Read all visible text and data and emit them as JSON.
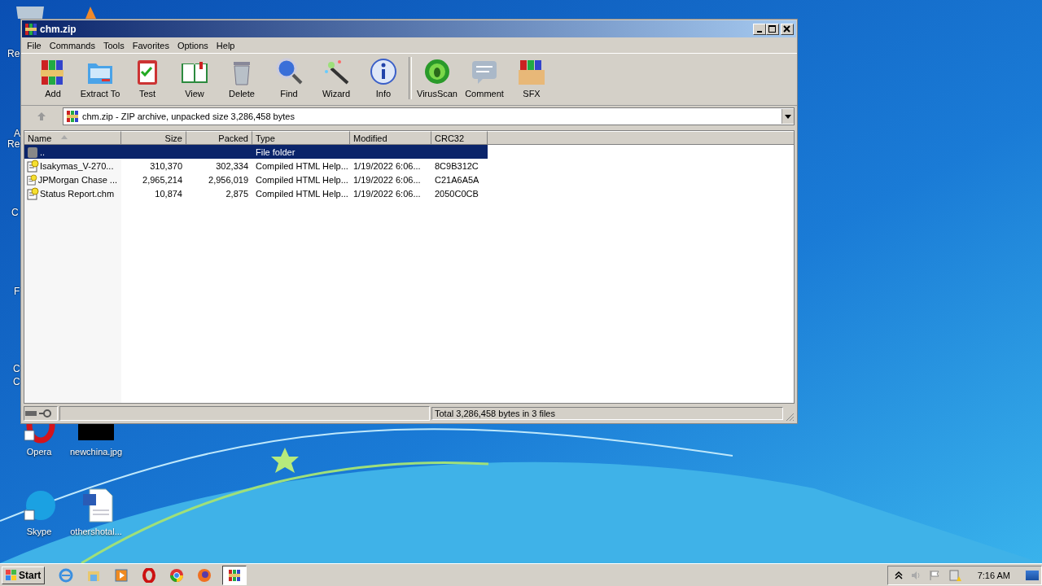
{
  "desktop": {
    "edge_labels": [
      "Re",
      "A",
      "Re",
      "C",
      "F",
      "C",
      "C"
    ],
    "icons": [
      {
        "label": "Opera",
        "kind": "opera"
      },
      {
        "label": "newchina.jpg"
      },
      {
        "label": "Skype",
        "kind": "skype"
      },
      {
        "label": "othershotal...",
        "kind": "word"
      }
    ]
  },
  "window": {
    "title": "chm.zip",
    "menu": [
      "File",
      "Commands",
      "Tools",
      "Favorites",
      "Options",
      "Help"
    ],
    "toolbar_groups": [
      {
        "buttons": [
          {
            "label": "Add",
            "kind": "add"
          },
          {
            "label": "Extract To",
            "kind": "extract"
          },
          {
            "label": "Test",
            "kind": "test"
          },
          {
            "label": "View",
            "kind": "view"
          },
          {
            "label": "Delete",
            "kind": "delete"
          },
          {
            "label": "Find",
            "kind": "find"
          },
          {
            "label": "Wizard",
            "kind": "wizard"
          },
          {
            "label": "Info",
            "kind": "info"
          }
        ]
      },
      {
        "buttons": [
          {
            "label": "VirusScan",
            "kind": "virus"
          },
          {
            "label": "Comment",
            "kind": "comment"
          },
          {
            "label": "SFX",
            "kind": "sfx"
          }
        ]
      }
    ],
    "address": "chm.zip - ZIP archive, unpacked size 3,286,458 bytes",
    "table": {
      "columns": [
        {
          "label": "Name",
          "sorted": true
        },
        {
          "label": "Size",
          "sorted": false
        },
        {
          "label": "Packed",
          "sorted": false
        },
        {
          "label": "Type",
          "sorted": false
        },
        {
          "label": "Modified",
          "sorted": false
        },
        {
          "label": "CRC32",
          "sorted": false
        }
      ],
      "rows": [
        {
          "kind": "folder",
          "selected": true,
          "name": "..",
          "type": "File folder"
        },
        {
          "kind": "chm",
          "selected": false,
          "name": "Isakymas_V-270...",
          "size": "310,370",
          "packed": "302,334",
          "type": "Compiled HTML Help...",
          "modified": "1/19/2022 6:06...",
          "crc32": "8C9B312C"
        },
        {
          "kind": "chm",
          "selected": false,
          "name": "JPMorgan Chase ...",
          "size": "2,965,214",
          "packed": "2,956,019",
          "type": "Compiled HTML Help...",
          "modified": "1/19/2022 6:06...",
          "crc32": "C21A6A5A"
        },
        {
          "kind": "chm",
          "selected": false,
          "name": "Status Report.chm",
          "size": "10,874",
          "packed": "2,875",
          "type": "Compiled HTML Help...",
          "modified": "1/19/2022 6:06...",
          "crc32": "2050C0CB"
        }
      ]
    },
    "status_bar": "Total 3,286,458 bytes in 3 files"
  },
  "taskbar": {
    "start": "Start",
    "apps": [
      {
        "kind": "ie",
        "selected": false
      },
      {
        "kind": "explorer",
        "selected": false
      },
      {
        "kind": "media",
        "selected": false
      },
      {
        "kind": "opera",
        "selected": false
      },
      {
        "kind": "chrome",
        "selected": false
      },
      {
        "kind": "firefox",
        "selected": false
      },
      {
        "kind": "winrar",
        "selected": true
      }
    ],
    "clock": "7:16 AM"
  }
}
